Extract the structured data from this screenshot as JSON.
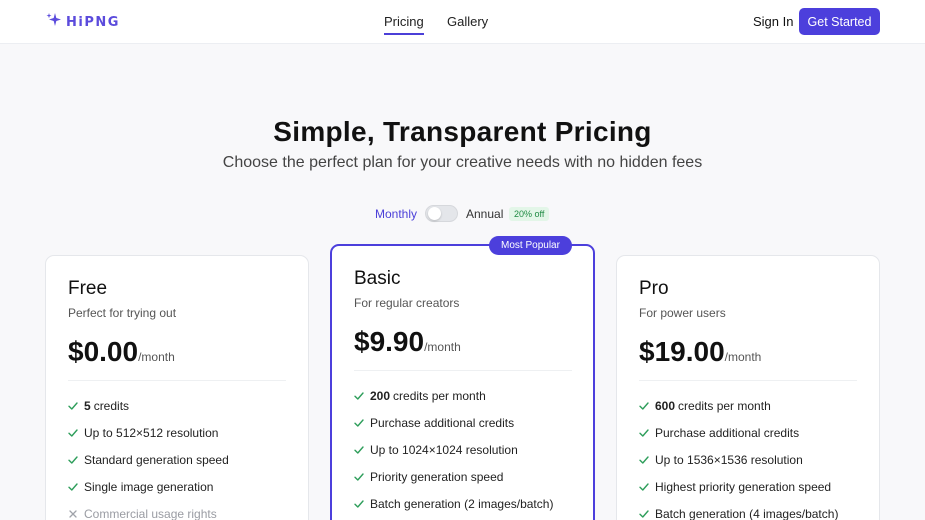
{
  "brand": {
    "name": "HiPNG",
    "icon": "sparkle-icon",
    "color": "#5b4bdc"
  },
  "nav": {
    "links": [
      {
        "label": "Pricing",
        "active": true
      },
      {
        "label": "Gallery",
        "active": false
      }
    ]
  },
  "auth": {
    "sign_in": "Sign In",
    "get_started": "Get Started"
  },
  "hero": {
    "title": "Simple, Transparent Pricing",
    "subtitle": "Choose the perfect plan for your creative needs with no hidden fees"
  },
  "billing": {
    "monthly": "Monthly",
    "annual": "Annual",
    "discount": "20% off",
    "annual_selected": false
  },
  "plans": [
    {
      "name": "Free",
      "description": "Perfect for trying out",
      "price": "$0.00",
      "period": "/month",
      "featured": false,
      "features": [
        {
          "strong": "5",
          "text": "credits",
          "included": true
        },
        {
          "strong": "",
          "text": "Up to 512×512 resolution",
          "included": true
        },
        {
          "strong": "",
          "text": "Standard generation speed",
          "included": true
        },
        {
          "strong": "",
          "text": "Single image generation",
          "included": true
        },
        {
          "strong": "",
          "text": "Commercial usage rights",
          "included": false
        }
      ]
    },
    {
      "name": "Basic",
      "description": "For regular creators",
      "price": "$9.90",
      "period": "/month",
      "featured": true,
      "badge": "Most Popular",
      "features": [
        {
          "strong": "200",
          "text": "credits per month",
          "included": true
        },
        {
          "strong": "",
          "text": "Purchase additional credits",
          "included": true
        },
        {
          "strong": "",
          "text": "Up to 1024×1024 resolution",
          "included": true
        },
        {
          "strong": "",
          "text": "Priority generation speed",
          "included": true
        },
        {
          "strong": "",
          "text": "Batch generation (2 images/batch)",
          "included": true
        }
      ]
    },
    {
      "name": "Pro",
      "description": "For power users",
      "price": "$19.00",
      "period": "/month",
      "featured": false,
      "features": [
        {
          "strong": "600",
          "text": "credits per month",
          "included": true
        },
        {
          "strong": "",
          "text": "Purchase additional credits",
          "included": true
        },
        {
          "strong": "",
          "text": "Up to 1536×1536 resolution",
          "included": true
        },
        {
          "strong": "",
          "text": "Highest priority generation speed",
          "included": true
        },
        {
          "strong": "",
          "text": "Batch generation (4 images/batch)",
          "included": true
        }
      ]
    }
  ],
  "colors": {
    "accent": "#4c3fdc",
    "check": "#2e9e5b",
    "cross": "#a0a3aa",
    "discount_bg": "#e3f6e8",
    "discount_text": "#1f8a43"
  }
}
